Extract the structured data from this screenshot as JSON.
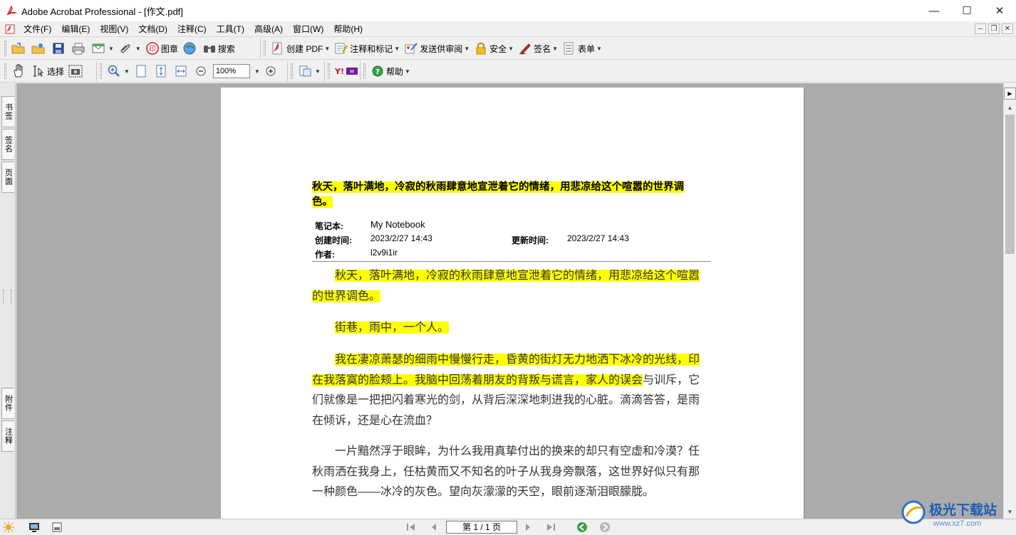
{
  "window": {
    "title": "Adobe Acrobat Professional - [作文.pdf]",
    "minimize": "—",
    "maximize": "☐",
    "close": "✕"
  },
  "menu": [
    "文件(F)",
    "编辑(E)",
    "视图(V)",
    "文档(D)",
    "注释(C)",
    "工具(T)",
    "高级(A)",
    "窗口(W)",
    "帮助(H)"
  ],
  "toolbar1": {
    "stamp": "图章",
    "search": "搜索",
    "create_pdf": "创建 PDF",
    "comment_markup": "注释和标记",
    "send_review": "发送供审阅",
    "security": "安全",
    "sign": "签名",
    "forms": "表单"
  },
  "toolbar2": {
    "select": "选择",
    "zoom_value": "100%",
    "help": "帮助"
  },
  "left_tabs": {
    "bookmarks": "书签",
    "signatures": "签名",
    "pages": "页面",
    "attachments": "附件",
    "comments": "注释"
  },
  "document": {
    "title": "秋天，落叶满地，冷寂的秋雨肆意地宣泄着它的情绪，用悲凉给这个喧嚣的世界调色。",
    "meta": {
      "notebook_label": "笔记本:",
      "notebook_value": "My Notebook",
      "created_label": "创建时间:",
      "created_value": "2023/2/27 14:43",
      "updated_label": "更新时间:",
      "updated_value": "2023/2/27 14:43",
      "author_label": "作者:",
      "author_value": "l2v9i1ir"
    },
    "p1": "秋天，落叶满地，冷寂的秋雨肆意地宣泄着它的情绪，用悲凉给这个喧嚣的世界调色。",
    "p2": "街巷，雨中，一个人。",
    "p3_highlight": "我在凄凉萧瑟的细雨中慢慢行走，昏黄的街灯无力地洒下冰冷的光线，印在我落寞的脸颊上。我脑中回荡着朋友的背叛与谎言，家人的误会",
    "p3_rest": "与训斥，它们就像是一把把闪着寒光的剑，从背后深深地刺进我的心脏。滴滴答答，是雨在倾诉，还是心在流血？",
    "p4": "一片黯然浮于眼眸，为什么我用真挚付出的换来的却只有空虚和冷漠？任秋雨洒在我身上，任枯黄而又不知名的叶子从我身旁飘落，这世界好似只有那一种颜色——冰冷的灰色。望向灰濛濛的天空，眼前逐渐泪眼朦胧。"
  },
  "status": {
    "page_indicator": "第 1 / 1 页"
  },
  "watermark": {
    "text": "极光下载站",
    "url": "www.xz7.com"
  }
}
